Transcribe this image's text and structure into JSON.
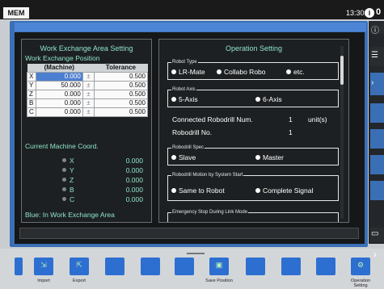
{
  "statusbar": {
    "mode": "MEM",
    "time": "13:30:02",
    "alarm_icon": "i",
    "alarm_count": "0"
  },
  "left_panel": {
    "title": "Work Exchange Area Setting",
    "subtitle": "Work Exchange Position",
    "table": {
      "headers": [
        "",
        "(Machine)",
        "",
        "Tolerance"
      ],
      "rows": [
        {
          "axis": "X",
          "value": "0.000",
          "pm": "±",
          "tol": "0.500"
        },
        {
          "axis": "Y",
          "value": "50.000",
          "pm": "±",
          "tol": "0.500"
        },
        {
          "axis": "Z",
          "value": "0.000",
          "pm": "±",
          "tol": "0.500"
        },
        {
          "axis": "B",
          "value": "0.000",
          "pm": "±",
          "tol": "0.500"
        },
        {
          "axis": "C",
          "value": "0.000",
          "pm": "±",
          "tol": "0.500"
        }
      ]
    },
    "coord_title": "Current Machine Coord.",
    "coords": [
      {
        "axis": "X",
        "value": "0.000"
      },
      {
        "axis": "Y",
        "value": "0.000"
      },
      {
        "axis": "Z",
        "value": "0.000"
      },
      {
        "axis": "B",
        "value": "0.000"
      },
      {
        "axis": "C",
        "value": "0.000"
      }
    ],
    "note": "Blue: In Work Exchange Area"
  },
  "right_panel": {
    "title": "Operation Setting",
    "robot_type": {
      "label": "Robot Type",
      "options": [
        "LR-Mate",
        "Collabo Robo",
        "etc."
      ]
    },
    "robot_axis": {
      "label": "Robot Axis",
      "options": [
        "5-Axis",
        "6-Axis"
      ]
    },
    "robodrill_num": {
      "label": "Connected Robodrill Num.",
      "value": "1",
      "unit": "unit(s)"
    },
    "robodrill_no": {
      "label": "Robodrill No.",
      "value": "1"
    },
    "robodrill_spec": {
      "label": "Robodrill Spec",
      "options": [
        "Slave",
        "Master"
      ]
    },
    "robodrill_motion": {
      "label": "Robodrill Motion by System Start",
      "options": [
        "Same to Robot",
        "Complete Signal"
      ]
    },
    "emergency": {
      "label": "Emergency Stop During Link Mode"
    }
  },
  "toolbar": {
    "buttons": [
      {
        "label": "Import"
      },
      {
        "label": "Export"
      },
      {
        "label": ""
      },
      {
        "label": ""
      },
      {
        "label": ""
      },
      {
        "label": "Save Position"
      },
      {
        "label": ""
      },
      {
        "label": ""
      },
      {
        "label": ""
      },
      {
        "label": "Operation Setting"
      }
    ]
  },
  "colors": {
    "accent": "#3a6fb5",
    "text_teal": "#8ee3c8",
    "selected_cell": "#4d7fd0"
  }
}
